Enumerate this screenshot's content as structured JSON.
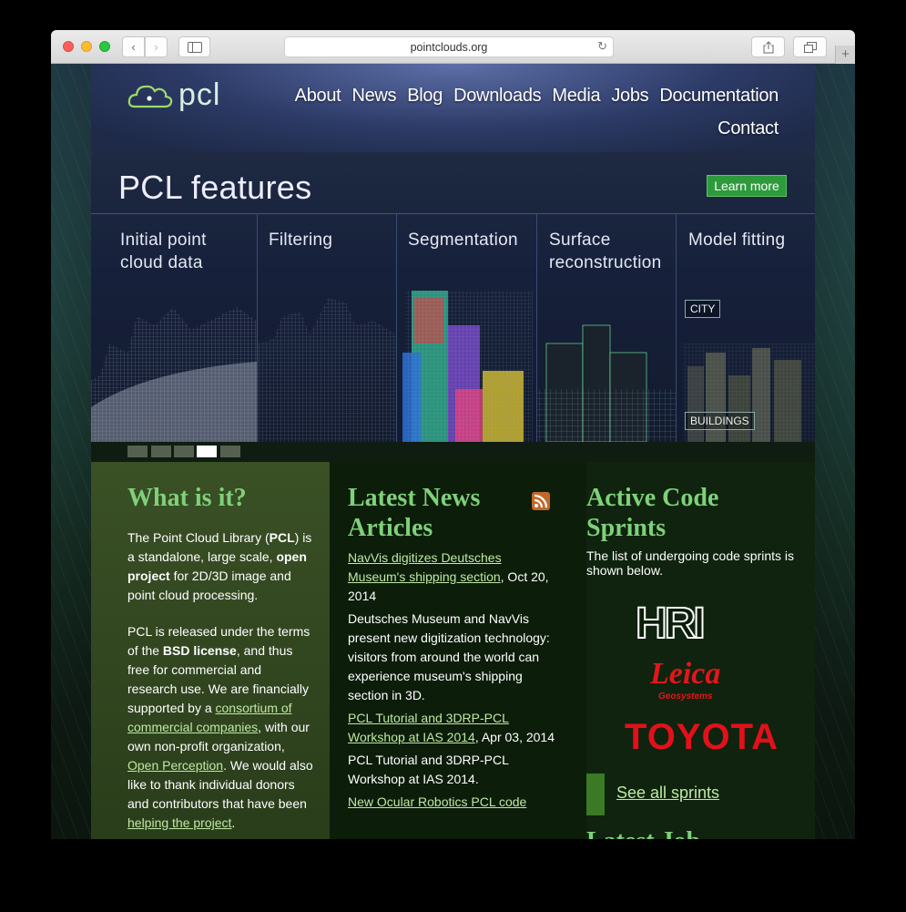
{
  "browser": {
    "url": "pointclouds.org",
    "reload_icon": "reload-icon"
  },
  "site": {
    "logo_text": "pcl",
    "nav": [
      "About",
      "News",
      "Blog",
      "Downloads",
      "Media",
      "Jobs",
      "Documentation",
      "Contact"
    ]
  },
  "banner": {
    "title": "PCL features",
    "learn_more": "Learn more",
    "columns": [
      {
        "label_line1": "Initial point",
        "label_line2": "cloud data"
      },
      {
        "label_line1": "Filtering",
        "label_line2": ""
      },
      {
        "label_line1": "Segmentation",
        "label_line2": ""
      },
      {
        "label_line1": "Surface",
        "label_line2": "reconstruction"
      },
      {
        "label_line1": "Model fitting",
        "label_line2": ""
      }
    ],
    "tags": {
      "city": "CITY",
      "buildings": "BUILDINGS"
    },
    "slides": 5,
    "active_slide": 4
  },
  "what": {
    "heading": "What is it?",
    "p1_pre": "The Point Cloud Library (",
    "p1_bold": "PCL",
    "p1_mid": ") is a standalone, large scale, ",
    "p1_bold2": "open project",
    "p1_post": " for 2D/3D image and point cloud processing.",
    "p2_pre": "PCL is released under the terms of the ",
    "p2_bold": "BSD license",
    "p2_mid": ", and thus free for commercial and research use. We are financially supported by a ",
    "p2_link1": "consortium of commercial companies",
    "p2_mid2": ", with our own non-profit organization, ",
    "p2_link2": "Open Perception",
    "p2_mid3": ". We would also like to thank individual donors and contributors that have been ",
    "p2_link3": "helping the project",
    "p2_end": "."
  },
  "news": {
    "heading_line1": "Latest News",
    "heading_line2": "Articles",
    "rss_icon": "rss-icon",
    "items": [
      {
        "title": "NavVis digitizes Deutsches Museum's shipping section",
        "date": ", Oct 20, 2014",
        "summary": "Deutsches Museum and NavVis present new digitization technology: visitors from around the world can experience museum's shipping section in 3D."
      },
      {
        "title": "PCL Tutorial and 3DRP-PCL Workshop at IAS 2014",
        "date": ", Apr 03, 2014",
        "summary": "PCL Tutorial and 3DRP-PCL Workshop at IAS 2014."
      },
      {
        "title": "New Ocular Robotics PCL code",
        "date": "",
        "summary": ""
      }
    ]
  },
  "sprints": {
    "heading_line1": "Active Code",
    "heading_line2": "Sprints",
    "intro": "The list of undergoing code sprints is shown below.",
    "brands": {
      "hri": "HRI",
      "leica": "Leica",
      "leica_sub": "Geosystems",
      "toyota": "TOYOTA"
    },
    "see_all": "See all sprints",
    "next_heading": "Latest Job"
  },
  "colors": {
    "accent_green": "#7fd07a",
    "button_green": "#2d9a3c",
    "brand_red": "#e3161c"
  }
}
